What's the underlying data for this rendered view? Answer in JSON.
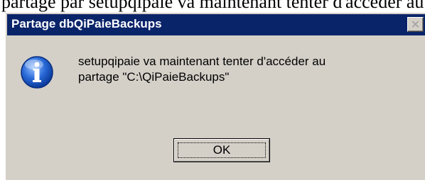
{
  "background_text": "partagé par setupqipaie va maintenant tenter d'accéder au partage qipaie sur le poste client Q",
  "dialog": {
    "title": "Partage dbQiPaieBackups",
    "close_symbol": "✕",
    "icon": "info-icon",
    "message_line1": "setupqipaie va maintenant tenter d'accéder au",
    "message_line2": "partage \"C:\\QiPaieBackups\"",
    "ok_label": "OK"
  },
  "colors": {
    "titlebar": "#0a246a",
    "dialog_bg": "#d4d0c8",
    "icon_blue": "#1d5fc4"
  }
}
